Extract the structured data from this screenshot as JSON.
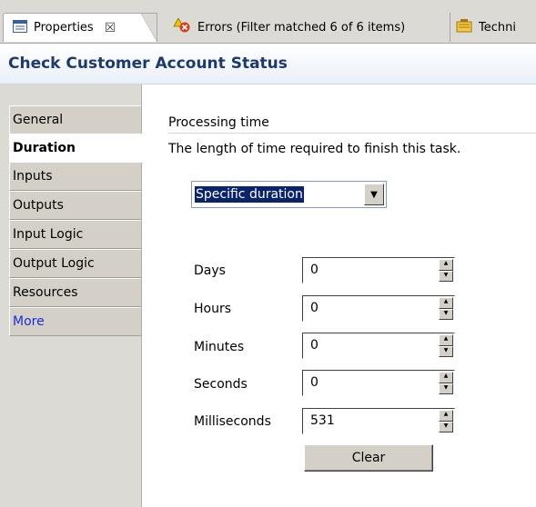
{
  "tabs": [
    {
      "label": "Properties",
      "icon": "properties-icon",
      "close": "☒",
      "active": true
    },
    {
      "label": "Errors (Filter matched 6 of 6 items)",
      "icon": "errors-icon",
      "active": false
    },
    {
      "label": "Techni",
      "icon": "technical-icon",
      "active": false
    }
  ],
  "header": {
    "title": "Check Customer Account Status"
  },
  "sidebar": {
    "items": [
      {
        "label": "General",
        "selected": false
      },
      {
        "label": "Duration",
        "selected": true
      },
      {
        "label": "Inputs",
        "selected": false
      },
      {
        "label": "Outputs",
        "selected": false
      },
      {
        "label": "Input Logic",
        "selected": false
      },
      {
        "label": "Output Logic",
        "selected": false
      },
      {
        "label": "Resources",
        "selected": false
      },
      {
        "label": "More",
        "selected": false,
        "link": true
      }
    ]
  },
  "main": {
    "section_title": "Processing time",
    "description": "The length of time required to finish this task.",
    "duration_type": {
      "selected": "Specific duration"
    },
    "fields": [
      {
        "label": "Days",
        "value": "0"
      },
      {
        "label": "Hours",
        "value": "0"
      },
      {
        "label": "Minutes",
        "value": "0"
      },
      {
        "label": "Seconds",
        "value": "0"
      },
      {
        "label": "Milliseconds",
        "value": "531"
      }
    ],
    "clear_label": "Clear"
  },
  "colors": {
    "title": "#1c3a6e",
    "link": "#1a2fd6",
    "selection": "#0a246a",
    "panel": "#d4d0c8"
  }
}
